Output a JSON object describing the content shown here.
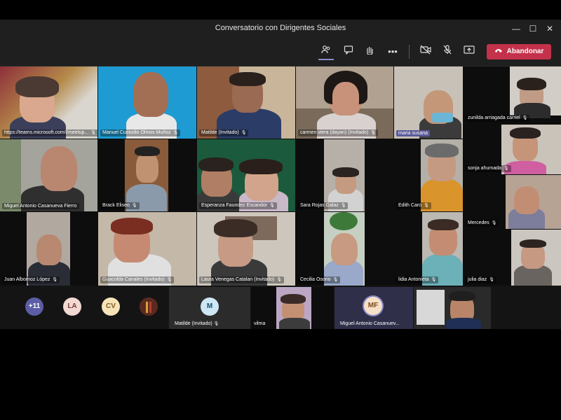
{
  "window": {
    "title": "Conversatorio con Dirigentes Sociales",
    "minimize": "—",
    "maximize": "☐",
    "close": "✕"
  },
  "toolbar": {
    "leave_label": "Abandonar",
    "more": "•••"
  },
  "tiles": [
    {
      "name": "https://teams.microsoft.com/l/meetup..."
    },
    {
      "name": "Manuel Custodio Olmos Muñoz"
    },
    {
      "name": "Matilde (Invitado)"
    },
    {
      "name": "carmen viera (dayan) (Invitado)"
    },
    {
      "name": "maria susana"
    },
    {
      "name": "zunilda arriagada carriel"
    },
    {
      "name": "Miguel Antonio Casanueva Fierro"
    },
    {
      "name": "Brack Eliseo"
    },
    {
      "name": "Esperanza Faundez Escandor"
    },
    {
      "name": "Sara Rojas Galaz"
    },
    {
      "name": "Edith Caro"
    },
    {
      "name": "sonja ahumada"
    },
    {
      "name": "Mercedes"
    },
    {
      "name": "Juan Albornoz López"
    },
    {
      "name": "Guacolda Canales (Invitado)"
    },
    {
      "name": "Laura Venegas Catalan (Invitado)"
    },
    {
      "name": "Cecilia Osorio"
    },
    {
      "name": "lidia Antonieta"
    },
    {
      "name": "julia diaz"
    }
  ],
  "bottom": {
    "overflow_count": "+11",
    "avatars": [
      "LA",
      "CV",
      "MF"
    ],
    "matilde_initial": "M",
    "matilde_label": "Matilde (Invitado)",
    "vilma_label": "vilma",
    "miguel_label": "Miguel Antonio Casanuev..."
  },
  "colors": {
    "leave": "#c4314b",
    "accent": "#8b8cc7",
    "titlebar": "#1f1f1f"
  },
  "icons": [
    "participants-icon",
    "chat-icon",
    "raise-hand-icon",
    "more-icon",
    "camera-off-icon",
    "mic-off-icon",
    "share-icon",
    "phone-icon"
  ]
}
